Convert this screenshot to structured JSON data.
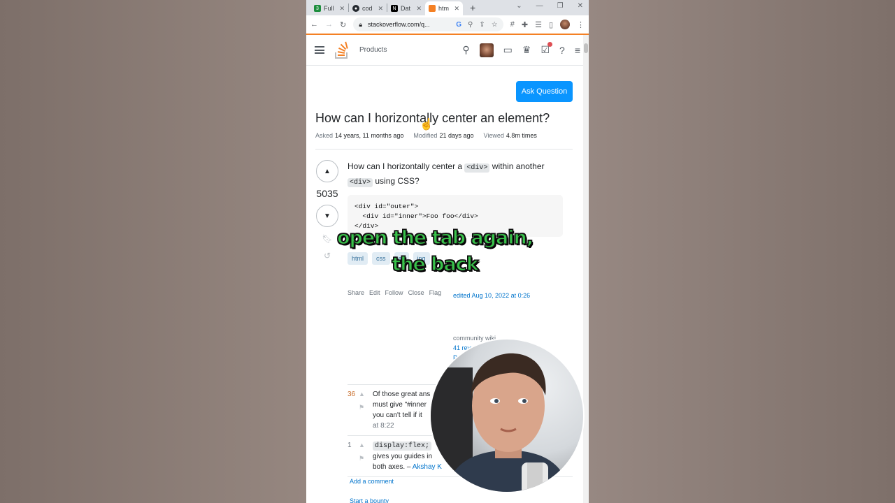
{
  "browser": {
    "tabs": [
      {
        "label": "Full",
        "icon": "page-icon",
        "active": false
      },
      {
        "label": "cod",
        "icon": "github-icon",
        "active": false
      },
      {
        "label": "Dat",
        "icon": "notion-icon",
        "active": false
      },
      {
        "label": "htm",
        "icon": "stackoverflow-icon",
        "active": true
      }
    ],
    "url": "stackoverflow.com/q..."
  },
  "so_header": {
    "products": "Products"
  },
  "question": {
    "ask_button": "Ask Question",
    "title": "How can I horizontally center an element?",
    "asked_label": "Asked",
    "asked_value": "14 years, 11 months ago",
    "modified_label": "Modified",
    "modified_value": "21 days ago",
    "viewed_label": "Viewed",
    "viewed_value": "4.8m times",
    "votes": "5035",
    "body_a": "How can I horizontally center a ",
    "body_code1": "<div>",
    "body_b": " within another ",
    "body_code2": "<div>",
    "body_c": " using CSS?",
    "code_line1": "<div id=\"outer\">",
    "code_line2": "  <div id=\"inner\">Foo foo</div>",
    "code_line3": "</div>",
    "tags": [
      "html",
      "css",
      "ali",
      "ing"
    ],
    "menu": [
      "Share",
      "Edit",
      "Follow",
      "Close",
      "Flag"
    ],
    "edited": "edited Aug 10, 2022 at 0:26",
    "wiki_label": "community wiki",
    "wiki_revs": "41 revs",
    "wiki_more": "Pe"
  },
  "comments": [
    {
      "score": "36",
      "line1": "Of those great ans",
      "line2": "must give \"#inner",
      "line3": "you can't tell if it",
      "date": "at 8:22"
    },
    {
      "score": "1",
      "code": "display:flex;",
      "line2": "gives you guides in",
      "line3": "both axes. – ",
      "user": "Akshay K"
    }
  ],
  "links": {
    "add_comment": "Add a comment",
    "bounty": "Start a bounty"
  },
  "caption": {
    "line1": "open the tab again,",
    "line2": "the back"
  }
}
